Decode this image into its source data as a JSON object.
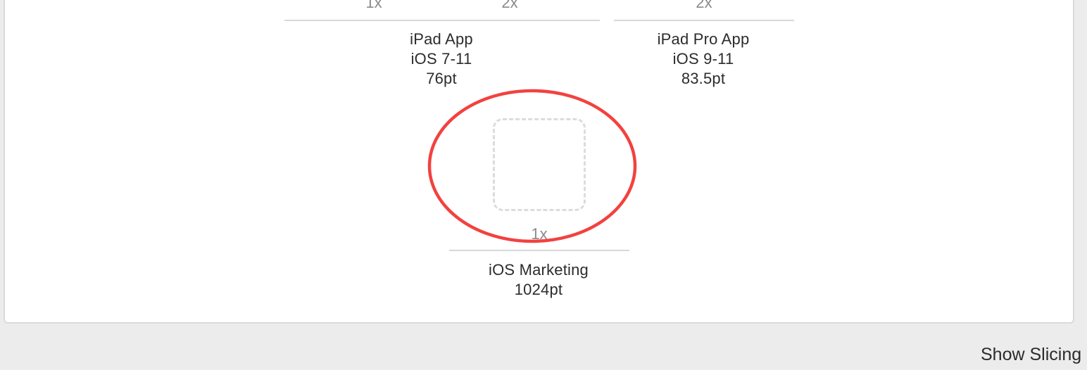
{
  "top_row": {
    "scale_labels": [
      "1x",
      "2x",
      "2x"
    ]
  },
  "groups": [
    {
      "lines": [
        "iPad App",
        "iOS 7-11",
        "76pt"
      ]
    },
    {
      "lines": [
        "iPad Pro App",
        "iOS 9-11",
        "83.5pt"
      ]
    },
    {
      "lines": [
        "iOS Marketing",
        "1024pt"
      ],
      "scale_label": "1x"
    }
  ],
  "annotation": {
    "color": "#f2423f",
    "shape": "ellipse"
  },
  "bottom_bar": {
    "show_slicing_label": "Show Slicing"
  }
}
